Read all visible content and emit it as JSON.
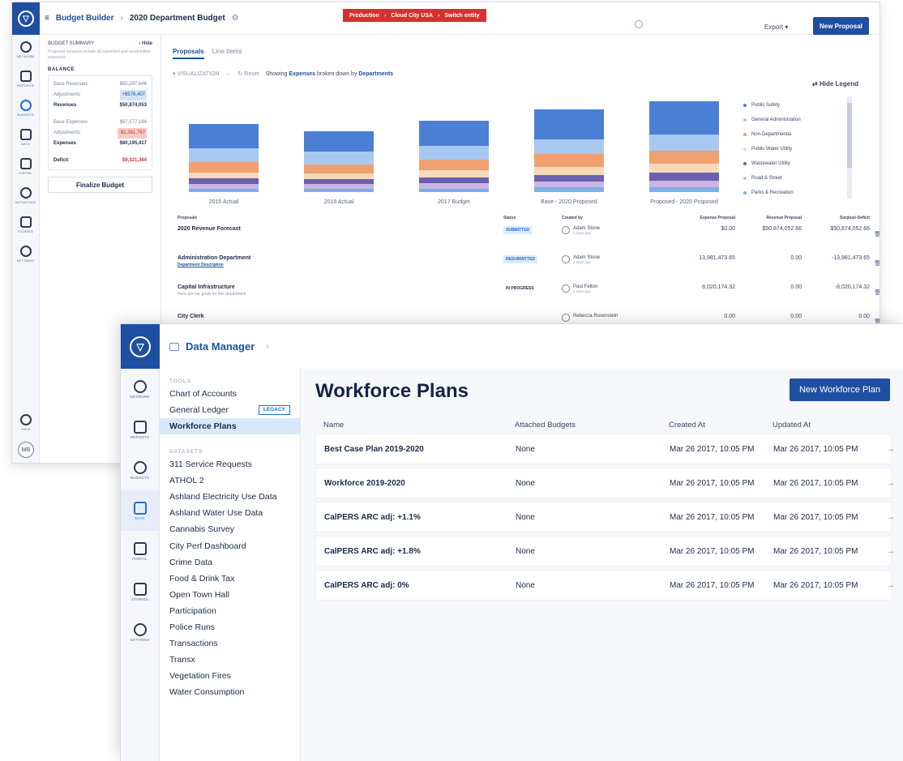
{
  "budget_builder": {
    "breadcrumb": {
      "app": "Budget Builder",
      "page": "2020 Department Budget"
    },
    "env_banner": {
      "env": "Production",
      "entity": "Cloud City USA",
      "action": "Switch entity"
    },
    "export_label": "Export",
    "new_proposal_label": "New Proposal",
    "rail": [
      "NETWORK",
      "REPORTS",
      "BUDGETS",
      "DATA",
      "PORTAL",
      "INITIATIVES",
      "STORIES",
      "SETTINGS"
    ],
    "help_label": "HELP",
    "avatar_initials": "MB",
    "summary": {
      "title": "BUDGET SUMMARY",
      "hide": "Hide",
      "note": "Proposed amounts include all submitted and resubmitted proposals.",
      "balance_label": "BALANCE",
      "rows1": [
        {
          "label": "Base Revenues",
          "value": "$50,297,646"
        },
        {
          "label": "Adjustments",
          "value": "+$576,407"
        },
        {
          "label": "Revenues",
          "value": "$50,874,053"
        }
      ],
      "rows2": [
        {
          "label": "Base Expenses",
          "value": "$67,577,184"
        },
        {
          "label": "Adjustments",
          "value": "-$2,381,767"
        },
        {
          "label": "Expenses",
          "value": "$60,195,417"
        }
      ],
      "deficit": {
        "label": "Deficit",
        "value": "$9,321,364"
      },
      "finalize_label": "Finalize Budget"
    },
    "tabs": [
      "Proposals",
      "Line Items"
    ],
    "vis": {
      "label": "VISUALIZATION",
      "reset": "Reset",
      "text_pre": "Showing",
      "measure": "Expenses",
      "text_mid": "broken down by",
      "dimension": "Departments",
      "hide_legend": "Hide Legend"
    },
    "chart_data": {
      "type": "bar",
      "stacked": true,
      "categories": [
        "2015 Actual",
        "2016 Actual",
        "2017 Budget",
        "Base - 2020 Proposed",
        "Proposed - 2020 Proposed"
      ],
      "legend": [
        {
          "name": "Public Safety",
          "color": "#4a7fd4"
        },
        {
          "name": "General Administration",
          "color": "#a9c8ef"
        },
        {
          "name": "Non-Departmental",
          "color": "#f0a070"
        },
        {
          "name": "Public Water Utility",
          "color": "#f6d9b8"
        },
        {
          "name": "Wastewater Utility",
          "color": "#6a5fb0"
        },
        {
          "name": "Road & Street",
          "color": "#c9b5e3"
        },
        {
          "name": "Parks & Recreation",
          "color": "#7ab0e6"
        }
      ],
      "series": [
        {
          "name": "Public Safety",
          "values": [
            21,
            18,
            22,
            26,
            29
          ]
        },
        {
          "name": "General Administration",
          "values": [
            12,
            11,
            12,
            13,
            14
          ]
        },
        {
          "name": "Non-Departmental",
          "values": [
            9,
            8,
            9,
            11,
            11
          ]
        },
        {
          "name": "Public Water Utility",
          "values": [
            5,
            5,
            6,
            7,
            8
          ]
        },
        {
          "name": "Wastewater Utility",
          "values": [
            5,
            4,
            5,
            6,
            7
          ]
        },
        {
          "name": "Road & Street",
          "values": [
            4,
            4,
            5,
            5,
            6
          ]
        },
        {
          "name": "Parks & Recreation",
          "values": [
            3,
            3,
            3,
            4,
            4
          ]
        }
      ]
    },
    "proposals": {
      "headers": [
        "Proposals",
        "Status",
        "Created by",
        "Expense Proposal",
        "Revenue Proposal",
        "Surplus/-Deficit"
      ],
      "rows": [
        {
          "name": "2020 Revenue Forecast",
          "sub": "",
          "status": "SUBMITTED",
          "creator": "Adam Stone",
          "when": "5 days ago",
          "expense": "$0.00",
          "revenue": "$50,874,052.66",
          "surplus": "$50,874,052.66"
        },
        {
          "name": "Administration Department",
          "sub": "Department Description",
          "status": "RESUBMITTED",
          "creator": "Adam Stone",
          "when": "4 days ago",
          "expense": "13,981,473.65",
          "revenue": "0.00",
          "surplus": "-13,981,473.65"
        },
        {
          "name": "Capital Infrastructure",
          "sub": "Here are our goals for this department",
          "status": "IN PROGRESS",
          "creator": "Paul Felton",
          "when": "5 days ago",
          "expense": "8,020,174.32",
          "revenue": "0.00",
          "surplus": "-8,020,174.32"
        },
        {
          "name": "City Clerk",
          "sub": "",
          "status": "",
          "creator": "Rebecca Rosenstein",
          "when": "",
          "expense": "0.00",
          "revenue": "0.00",
          "surplus": "0.00"
        }
      ]
    }
  },
  "data_manager": {
    "title": "Data Manager",
    "rail": [
      "NETWORK",
      "REPORTS",
      "BUDGETS",
      "DATA",
      "PORTAL",
      "STORIES",
      "SETTINGS"
    ],
    "tools_label": "TOOLS",
    "tools": [
      "Chart of Accounts",
      "General Ledger",
      "Workforce Plans"
    ],
    "legacy_badge": "LEGACY",
    "datasets_label": "DATASETS",
    "datasets": [
      "311 Service Requests",
      "ATHOL 2",
      "Ashland Electricity Use Data",
      "Ashland Water Use Data",
      "Cannabis Survey",
      "City Perf Dashboard",
      "Crime Data",
      "Food & Drink Tax",
      "Open Town Hall",
      "Participation",
      "Police Runs",
      "Transactions",
      "Transx",
      "Vegetation Fires",
      "Water Consumption"
    ],
    "heading": "Workforce Plans",
    "new_button": "New Workforce Plan",
    "columns": [
      "Name",
      "Attached Budgets",
      "Created At",
      "Updated At"
    ],
    "rows": [
      {
        "name": "Best Case Plan 2019-2020",
        "budgets": "None",
        "created": "Mar 26 2017, 10:05 PM",
        "updated": "Mar 26 2017, 10:05 PM"
      },
      {
        "name": "Workforce 2019-2020",
        "budgets": "None",
        "created": "Mar 26 2017, 10:05 PM",
        "updated": "Mar 26 2017, 10:05 PM"
      },
      {
        "name": "CalPERS ARC adj: +1.1%",
        "budgets": "None",
        "created": "Mar 26 2017, 10:05 PM",
        "updated": "Mar 26 2017, 10:05 PM"
      },
      {
        "name": "CalPERS ARC adj: +1.8%",
        "budgets": "None",
        "created": "Mar 26 2017, 10:05 PM",
        "updated": "Mar 26 2017, 10:05 PM"
      },
      {
        "name": "CalPERS ARC adj: 0%",
        "budgets": "None",
        "created": "Mar 26 2017, 10:05 PM",
        "updated": "Mar 26 2017, 10:05 PM"
      }
    ]
  }
}
